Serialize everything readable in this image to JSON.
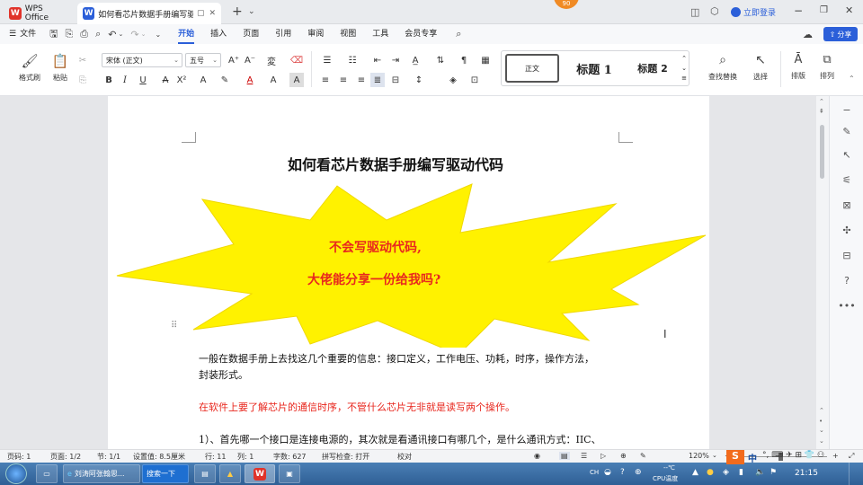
{
  "tabs": {
    "app": "WPS Office",
    "doc": "如何看芯片数据手册编写驱动",
    "new_tab": "+",
    "dropdown": "⌄",
    "badge": "90",
    "login": "立即登录"
  },
  "menu": {
    "file": "文件",
    "items": [
      "开始",
      "插入",
      "页面",
      "引用",
      "审阅",
      "视图",
      "工具",
      "会员专享"
    ],
    "share": "分享"
  },
  "ribbon": {
    "format_painter": "格式刷",
    "paste": "粘贴",
    "font_name": "宋体 (正文)",
    "font_size": "五号",
    "styles": [
      "正文",
      "标题 1",
      "标题 2"
    ],
    "find_replace": "查找替换",
    "select": "选择",
    "layout": "排版",
    "arrange": "排列"
  },
  "document": {
    "title": "如何看芯片数据手册编写驱动代码",
    "burst_line1": "不会写驱动代码,",
    "burst_line2": "大佬能分享一份给我吗?",
    "para1_line1": "一般在数据手册上去找这几个重要的信息：接口定义，工作电压、功耗，时序，操作方法，",
    "para1_line2": "封装形式。",
    "para2": "在软件上要了解芯片的通信时序，不管什么芯片无非就是读写两个操作。",
    "para3": "1）、首先哪一个接口是连接电源的，其次就是看通讯接口有哪几个，是什么通讯方式：IIC、"
  },
  "status": {
    "page_num": "页码: 1",
    "pages": "页面: 1/2",
    "section": "节: 1/1",
    "setting": "设置值: 8.5厘米",
    "row": "行: 11",
    "col": "列: 1",
    "words": "字数: 627",
    "spell": "拼写检查: 打开",
    "proof": "校对",
    "zoom": "120%"
  },
  "taskbar": {
    "item1": "刘涛阿张翰思...",
    "search": "搜索一下",
    "cpu": "CPU温度",
    "temp": "--℃",
    "time": "21:15",
    "ime": "中"
  },
  "colors": {
    "accent": "#2b5fd9",
    "red_text": "#e8271e",
    "burst_fill": "#fff200",
    "burst_text": "#e8271e",
    "wps_red": "#e0332a"
  }
}
